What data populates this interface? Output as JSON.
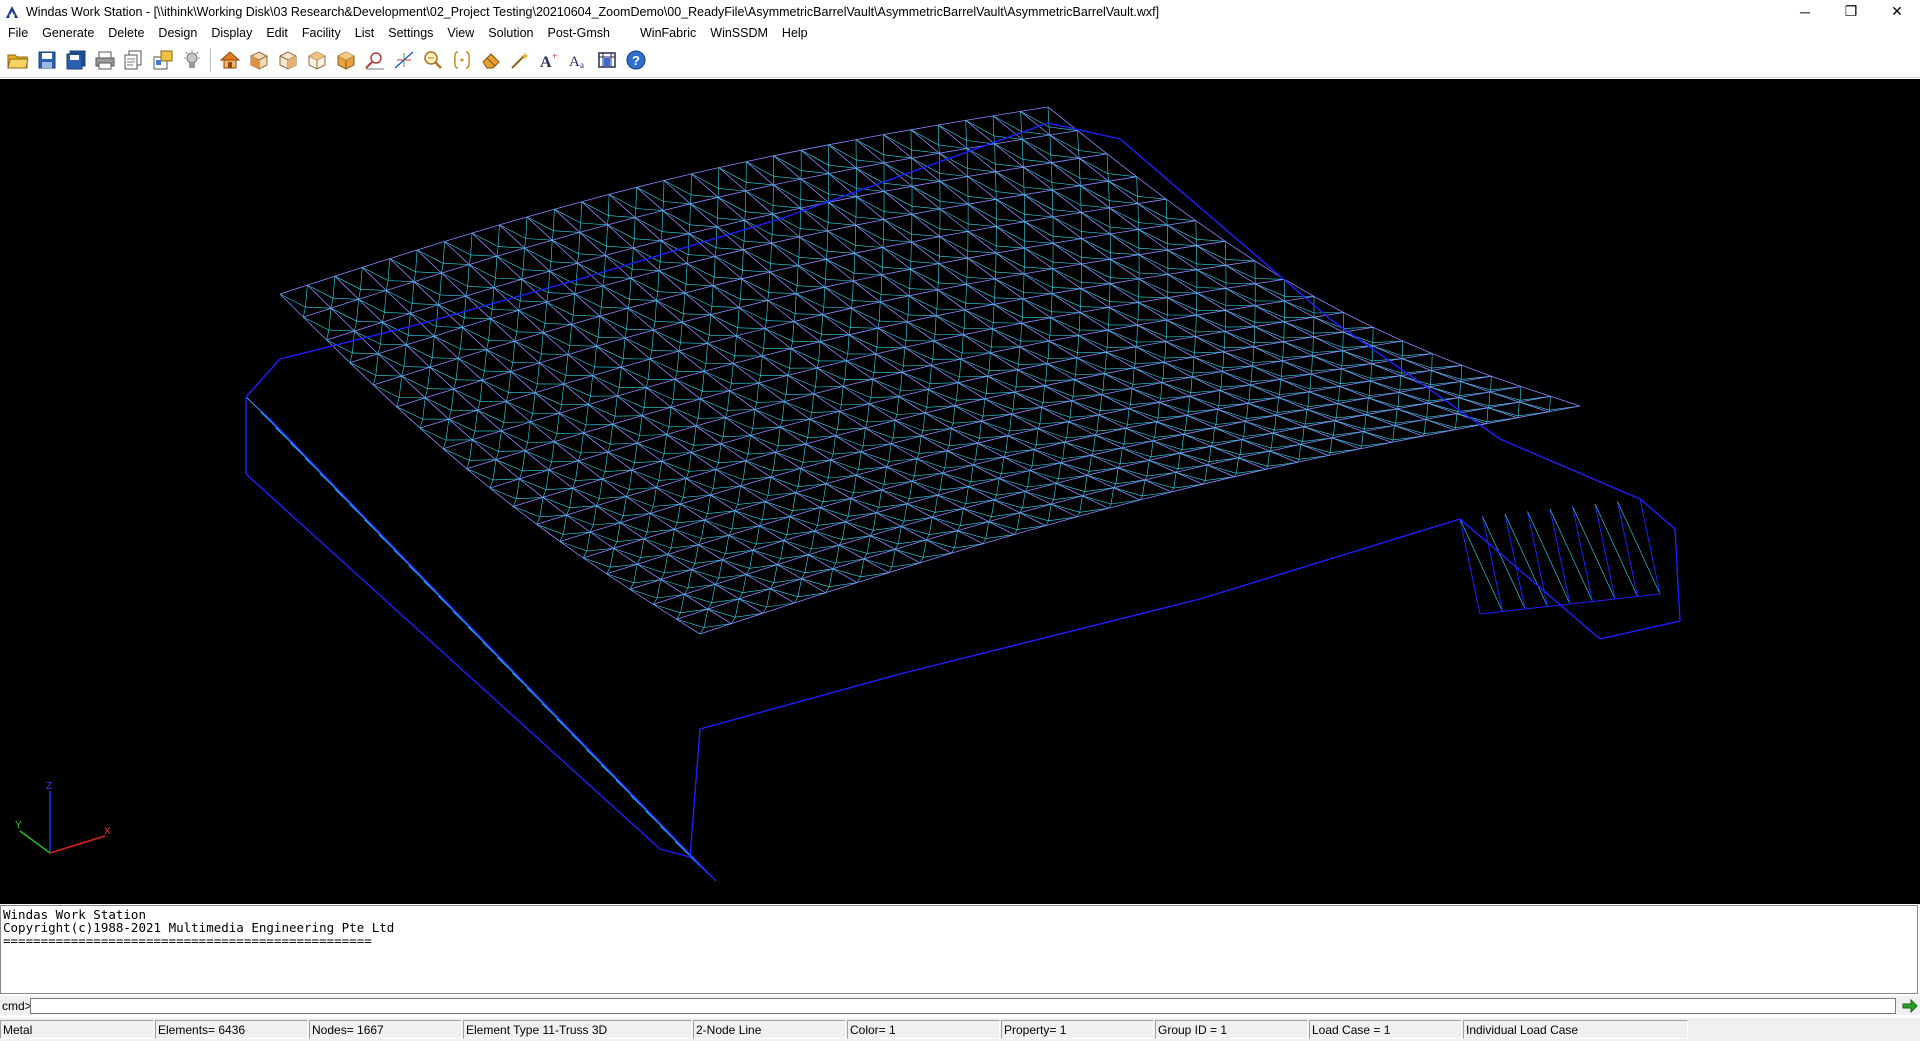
{
  "window": {
    "title": "Windas Work Station - [\\\\ithink\\Working Disk\\03 Research&Development\\02_Project Testing\\20210604_ZoomDemo\\00_ReadyFile\\AsymmetricBarrelVault\\AsymmetricBarrelVault\\AsymmetricBarrelVault.wxf]",
    "minimize": "─",
    "restore": "❐",
    "close": "✕"
  },
  "menu": [
    "File",
    "Generate",
    "Delete",
    "Design",
    "Display",
    "Edit",
    "Facility",
    "List",
    "Settings",
    "View",
    "Solution",
    "Post-Gmsh",
    "WinFabric",
    "WinSSDM",
    "Help"
  ],
  "toolbar": {
    "icons": [
      "open-folder-icon",
      "save-icon",
      "save-all-icon",
      "print-icon",
      "copy-icon",
      "export-icon",
      "light-icon",
      "home-view-icon",
      "box-front-icon",
      "box-side-icon",
      "box-iso-icon",
      "box-solid-icon",
      "zoom-window-icon",
      "axes-icon",
      "zoom-icon",
      "bracket-icon",
      "eraser-icon",
      "magic-icon",
      "font-size-icon",
      "font-style-icon",
      "frame-icon",
      "help-icon"
    ]
  },
  "viewport": {
    "background": "#000000",
    "axis_labels": {
      "x": "X",
      "y": "Y",
      "z": "Z"
    },
    "mesh_colors": {
      "outline": "#1f1fff",
      "chord": "#8a8aff",
      "diagonal": "#33ddee"
    }
  },
  "console": {
    "lines": [
      "Windas Work Station",
      "Copyright(c)1988-2021 Multimedia Engineering Pte Ltd",
      "================================================="
    ]
  },
  "command": {
    "label": "cmd>",
    "value": ""
  },
  "status": [
    "Metal",
    "Elements=  6436",
    "Nodes=  1667",
    "Element Type 11-Truss 3D",
    "2-Node Line",
    "Color= 1",
    "Property= 1",
    "Group ID =     1",
    "Load Case =    1",
    "Individual Load Case"
  ]
}
